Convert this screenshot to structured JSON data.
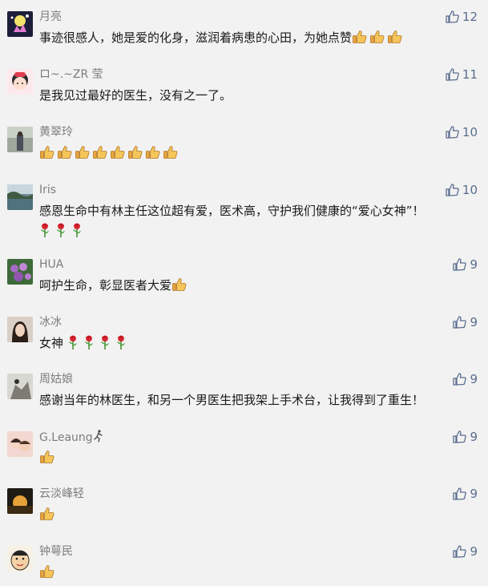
{
  "theme": {
    "like_color": "#5a6d8e",
    "name_color": "#7c7c7c",
    "background": "#f2f2f2"
  },
  "comments": [
    {
      "name": "月亮",
      "text": "事迹很感人，她是爱的化身，滋润着病患的心田，为她点赞",
      "thumbs": 3,
      "roses": 0,
      "likes": "12"
    },
    {
      "name": "ロ~.~ZR 莹",
      "text": "是我见过最好的医生，没有之一了。",
      "thumbs": 0,
      "roses": 0,
      "likes": "11"
    },
    {
      "name": "黄翠玲",
      "text": "",
      "thumbs": 8,
      "roses": 0,
      "likes": "10"
    },
    {
      "name": "Iris",
      "text": "感恩生命中有林主任这位超有爱，医术高，守护我们健康的“爱心女神”！",
      "thumbs": 0,
      "roses": 3,
      "likes": "10"
    },
    {
      "name": "HUA",
      "text": "呵护生命，彰显医者大爱",
      "thumbs": 1,
      "roses": 0,
      "likes": "9"
    },
    {
      "name": "冰冰",
      "text": "女神",
      "thumbs": 0,
      "roses": 4,
      "likes": "9"
    },
    {
      "name": "周姑娘",
      "text": "感谢当年的林医生，和另一个男医生把我架上手术台，让我得到了重生！",
      "thumbs": 0,
      "roses": 0,
      "likes": "9"
    },
    {
      "name": "G.Leaung",
      "text": "",
      "thumbs": 1,
      "roses": 0,
      "likes": "9"
    },
    {
      "name": "云淡峰轻",
      "text": "",
      "thumbs": 1,
      "roses": 0,
      "likes": "9"
    },
    {
      "name": "钟萼民",
      "text": "",
      "thumbs": 1,
      "roses": 0,
      "likes": "9"
    }
  ]
}
